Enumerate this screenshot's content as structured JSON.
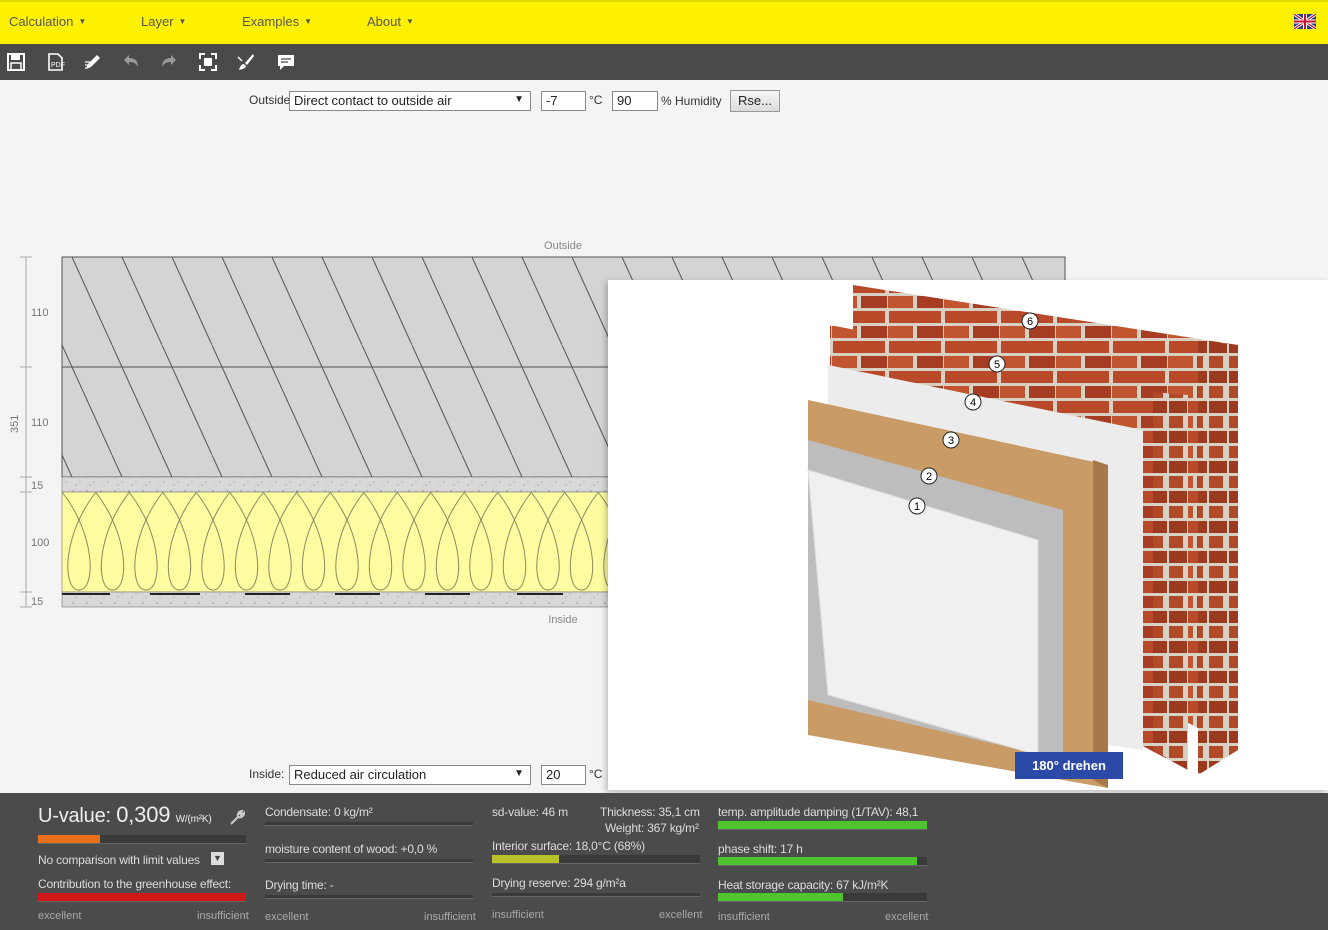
{
  "menu": {
    "items": [
      {
        "label": "Calculation"
      },
      {
        "label": "Layer"
      },
      {
        "label": "Examples"
      },
      {
        "label": "About"
      }
    ],
    "language_icon": "uk-flag-icon"
  },
  "toolbar": {
    "icons": [
      "save-icon",
      "pdf-icon",
      "edit-icon",
      "undo-icon",
      "redo-icon",
      "fit-icon",
      "brush-icon",
      "comment-icon"
    ]
  },
  "outside": {
    "label": "Outside",
    "select_value": "Direct contact to outside air",
    "temperature": "-7",
    "temp_unit": "°C",
    "humidity": "90",
    "humidity_unit": "% Humidity",
    "rse_button": "Rse..."
  },
  "inside": {
    "label": "Inside:",
    "select_value": "Reduced air circulation",
    "temperature": "20",
    "temp_unit": "°C"
  },
  "diagram": {
    "outside_caption": "Outside",
    "inside_caption": "Inside",
    "total_thickness": "351",
    "layer_thicknesses": [
      "110",
      "110",
      "15",
      "100",
      "15"
    ],
    "layer_colors": {
      "masonry": "#d4d4d4",
      "insulation": "#fdfca0",
      "plaster": "#d8d8d8"
    }
  },
  "photo": {
    "layer_markers": [
      "1",
      "2",
      "3",
      "4",
      "5",
      "6"
    ],
    "rotate_button": "180° drehen"
  },
  "results": {
    "u_value_label": "U-value:",
    "u_value": "0,309",
    "u_unit": "W/(m²K)",
    "u_fill": 0.3,
    "no_comparison": "No comparison with limit values",
    "greenhouse": "Contribution to the greenhouse effect:",
    "greenhouse_fill": 1.0,
    "condensate": "Condensate: 0 kg/m²",
    "moisture_wood": "moisture content of wood: +0,0 %",
    "drying_time": "Drying time: -",
    "sd_value": "sd-value: 46 m",
    "thickness": "Thickness: 35,1 cm",
    "weight": "Weight: 367 kg/m²",
    "interior_surface": "Interior surface: 18,0°C (68%)",
    "interior_fill": 0.32,
    "drying_reserve": "Drying reserve: 294 g/m²a",
    "temp_amplitude": "temp. amplitude damping (1/TAV): 48,1",
    "amplitude_fill": 1.0,
    "phase_shift": "phase shift: 17 h",
    "phase_fill": 0.95,
    "heat_storage": "Heat storage capacity: 67 kJ/m²K",
    "heat_fill": 0.6,
    "scale_excellent": "excellent",
    "scale_insufficient": "insufficient",
    "colors": {
      "orange": "#e8701a",
      "red": "#d01818",
      "green": "#4ec42e",
      "olive": "#b8c02a"
    }
  }
}
